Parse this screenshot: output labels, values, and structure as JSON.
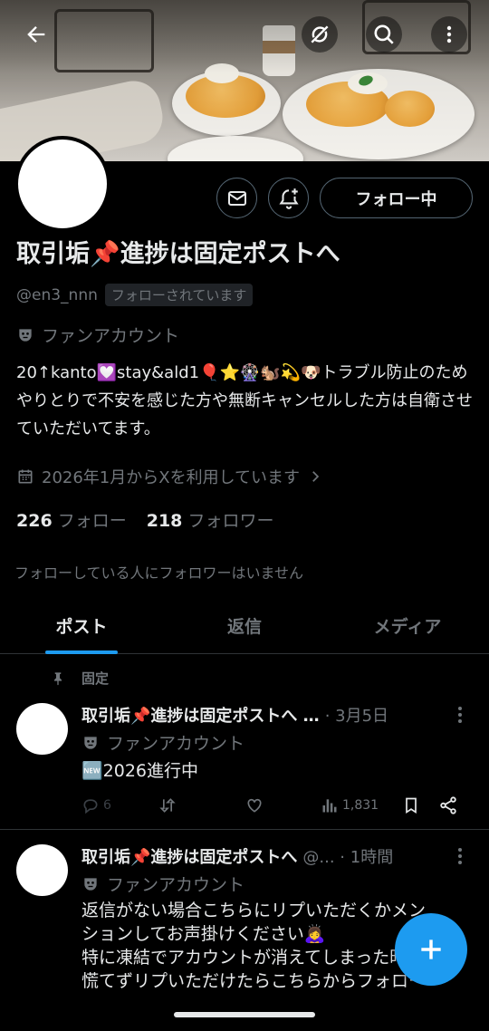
{
  "profile": {
    "display_name": "取引垢📌進捗は固定ポストへ",
    "handle": "@en3_nnn",
    "follows_you_badge": "フォローされています",
    "label": "ファンアカウント",
    "bio": "20↑kanto💟stay&ald1🎈⭐🎡🐿️💫🐶トラブル防止のためやりとりで不安を感じた方や無断キャンセルした方は自衛させていただいてます。",
    "joined": "2026年1月からXを利用しています",
    "following_count": "226",
    "following_label": "フォロー",
    "followers_count": "218",
    "followers_label": "フォロワー",
    "no_common_followers": "フォローしている人にフォロワーはいません",
    "follow_button_label": "フォロー中"
  },
  "tabs": [
    {
      "label": "ポスト",
      "active": true
    },
    {
      "label": "返信",
      "active": false
    },
    {
      "label": "メディア",
      "active": false
    }
  ],
  "pinned_label": "固定",
  "posts": [
    {
      "name": "取引垢📌進捗は固定ポストへ …",
      "meta": "· 3月5日",
      "label": "ファンアカウント",
      "body": "🆕2026進行中",
      "replies": "6",
      "reposts": "",
      "likes": "",
      "views": "1,831"
    },
    {
      "name": "取引垢📌進捗は固定ポストへ",
      "meta": "@... · 1時間",
      "label": "ファンアカウント",
      "body_lines": [
        "返信がない場合こちらにリプいただくかメン",
        "ションしてお声掛けください🙇‍♀️",
        "特に凍結でアカウントが消えてしまった時は",
        "慌てずリプいただけたらこちらからフォロー"
      ]
    }
  ],
  "colors": {
    "accent": "#1d9bf0",
    "background": "#000000",
    "text_primary": "#e7e9ea",
    "text_secondary": "#71767b",
    "border": "#2f3336"
  },
  "icons": [
    "back-arrow-icon",
    "sync-off-icon",
    "search-icon",
    "more-vertical-icon",
    "mail-icon",
    "notification-add-icon",
    "label-mask-icon",
    "calendar-icon",
    "chevron-right-icon",
    "pin-icon",
    "reply-icon",
    "repost-icon",
    "like-icon",
    "views-icon",
    "bookmark-icon",
    "share-icon",
    "compose-plus-icon"
  ]
}
